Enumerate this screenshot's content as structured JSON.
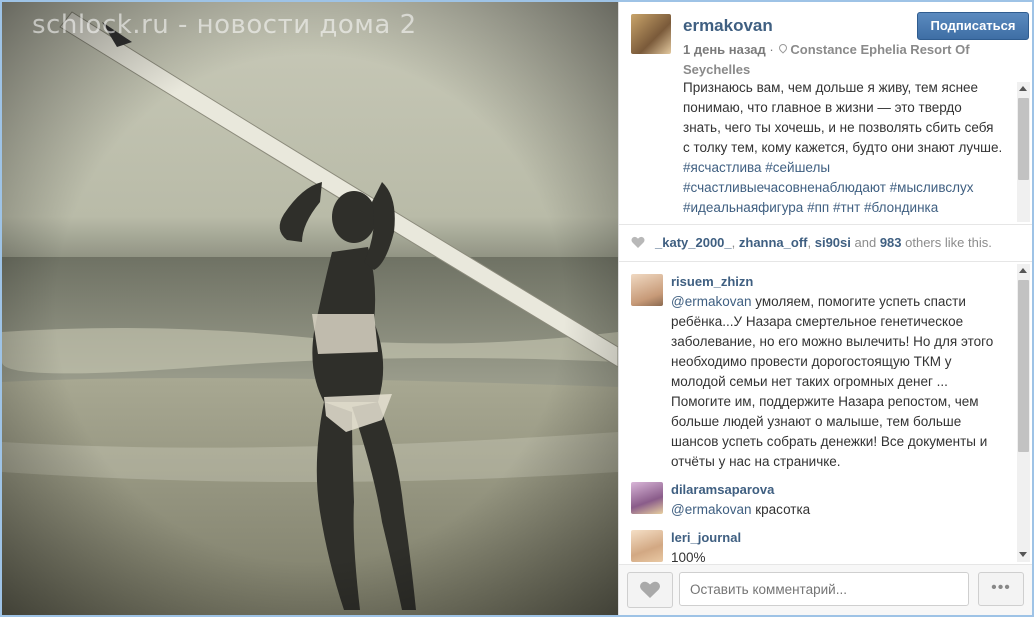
{
  "watermark": "schlock.ru - новости дома 2",
  "post": {
    "username": "ermakovan",
    "follow_label": "Подписаться",
    "time": "1 день назад",
    "separator": "·",
    "location": "Constance Ephelia Resort Of Seychelles",
    "caption": "Признаюсь вам, чем дольше я живу, тем яснее понимаю, что главное в жизни — это твердо знать, чего ты хочешь, и не позволять сбить себя с толку тем, кому кажется, будто они знают лучше.",
    "hashtags_line1": "#ясчастлива #сейшелы",
    "hashtags_line2": "#счастливыечасовненаблюдают #мысливслух",
    "hashtags_line3": "#идеальнаяфигура #пп #тнт #блондинка"
  },
  "likes": {
    "user1": "_katy_2000_",
    "sep1": ", ",
    "user2": "zhanna_off",
    "sep2": ", ",
    "user3": "si90si",
    "and_text": " and ",
    "count": "983",
    "suffix": " others like this."
  },
  "comments": [
    {
      "user": "risuem_zhizn",
      "mention": "@ermakovan",
      "text": " умоляем, помогите успеть спасти ребёнка...У Назара смертельное генетическое заболевание, но его можно вылечить! Но для этого необходимо провести дорогостоящую ТКМ у молодой семьи нет таких огромных денег ... Помогите им, поддержите Назара репостом, чем больше людей узнают о малыше, тем больше шансов успеть собрать денежки! Все документы и отчёты у нас на страничке."
    },
    {
      "user": "dilaramsaparova",
      "mention": "@ermakovan",
      "text": " красотка"
    },
    {
      "user": "leri_journal",
      "mention": "",
      "text": "100%"
    }
  ],
  "footer": {
    "comment_placeholder": "Оставить комментарий...",
    "more_label": "•••"
  },
  "colors": {
    "link": "#3f5f81",
    "follow_button": "#3e6ea5",
    "frame_border": "#9ec3e6"
  },
  "icons": {
    "heart": "heart-icon",
    "pin": "location-pin-icon",
    "more": "more-options-icon"
  }
}
